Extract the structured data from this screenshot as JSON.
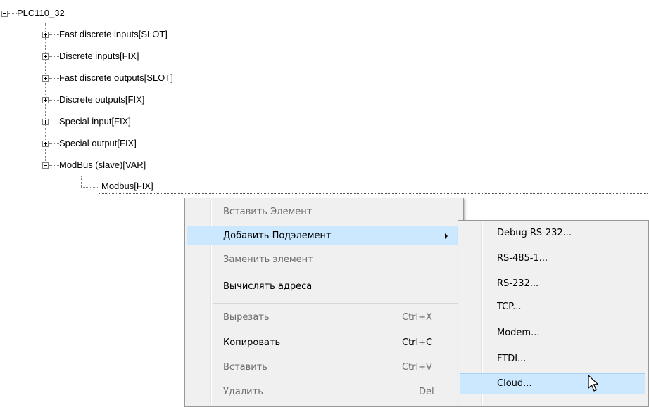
{
  "tree": {
    "root": {
      "label": "PLC110_32"
    },
    "children": [
      {
        "label": "Fast discrete inputs[SLOT]"
      },
      {
        "label": "Discrete inputs[FIX]"
      },
      {
        "label": "Fast discrete outputs[SLOT]"
      },
      {
        "label": "Discrete outputs[FIX]"
      },
      {
        "label": "Special input[FIX]"
      },
      {
        "label": "Special output[FIX]"
      },
      {
        "label": "ModBus (slave)[VAR]"
      }
    ],
    "modbus_child": {
      "label": "Modbus[FIX]"
    }
  },
  "context_menu": {
    "items": [
      {
        "label": "Вставить Элемент",
        "state": "disabled"
      },
      {
        "label": "Добавить Подэлемент",
        "state": "highlighted",
        "submenu": true
      },
      {
        "label": "Заменить элемент",
        "state": "disabled"
      },
      {
        "label": "Вычислять адреса",
        "state": "enabled"
      },
      {
        "label": "Вырезать",
        "shortcut": "Ctrl+X",
        "state": "disabled"
      },
      {
        "label": "Копировать",
        "shortcut": "Ctrl+C",
        "state": "enabled"
      },
      {
        "label": "Вставить",
        "shortcut": "Ctrl+V",
        "state": "disabled"
      },
      {
        "label": "Удалить",
        "shortcut": "Del",
        "state": "disabled"
      }
    ]
  },
  "submenu": {
    "items": [
      {
        "label": "Debug RS-232..."
      },
      {
        "label": "RS-485-1..."
      },
      {
        "label": "RS-232..."
      },
      {
        "label": "TCP..."
      },
      {
        "label": "Modem..."
      },
      {
        "label": "FTDI..."
      },
      {
        "label": "Cloud...",
        "state": "highlighted"
      }
    ]
  },
  "colors": {
    "highlight": "#cce8ff",
    "highlight_border": "#a8d2f5",
    "menu_bg": "#f0f0f0",
    "disabled_text": "#6d6d6d"
  }
}
